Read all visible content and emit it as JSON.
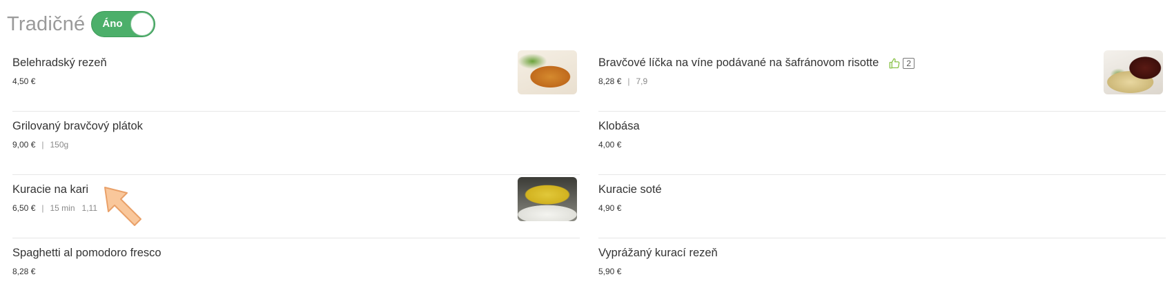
{
  "section": {
    "title": "Tradičné",
    "toggle_label": "Áno"
  },
  "left_items": [
    {
      "name": "Belehradský rezeň",
      "price": "4,50 €",
      "image": "breaded-schnitzel-photo"
    },
    {
      "name": "Grilovaný bravčový plátok",
      "price": "9,00 €",
      "extra1": "150g"
    },
    {
      "name": "Kuracie na kari",
      "price": "6,50 €",
      "extra1": "15 min",
      "extra2": "1,11",
      "image": "chicken-curry-rice-photo"
    },
    {
      "name": "Spaghetti al pomodoro fresco",
      "price": "8,28 €"
    }
  ],
  "right_items": [
    {
      "name": "Bravčové líčka na víne podávané na šafránovom risotte",
      "price": "8,28 €",
      "extra1": "7,9",
      "likes": "2",
      "like_icon": "thumbs-up-icon",
      "image": "pork-cheeks-risotto-photo"
    },
    {
      "name": "Klobása",
      "price": "4,00 €"
    },
    {
      "name": "Kuracie soté",
      "price": "4,90 €"
    },
    {
      "name": "Vyprážaný kurací rezeň",
      "price": "5,90 €"
    }
  ],
  "colors": {
    "toggle_on": "#4caf6a",
    "title_gray": "#9a9a9a",
    "like_icon": "#8bc34a",
    "arrow_fill": "#f9c79b"
  }
}
